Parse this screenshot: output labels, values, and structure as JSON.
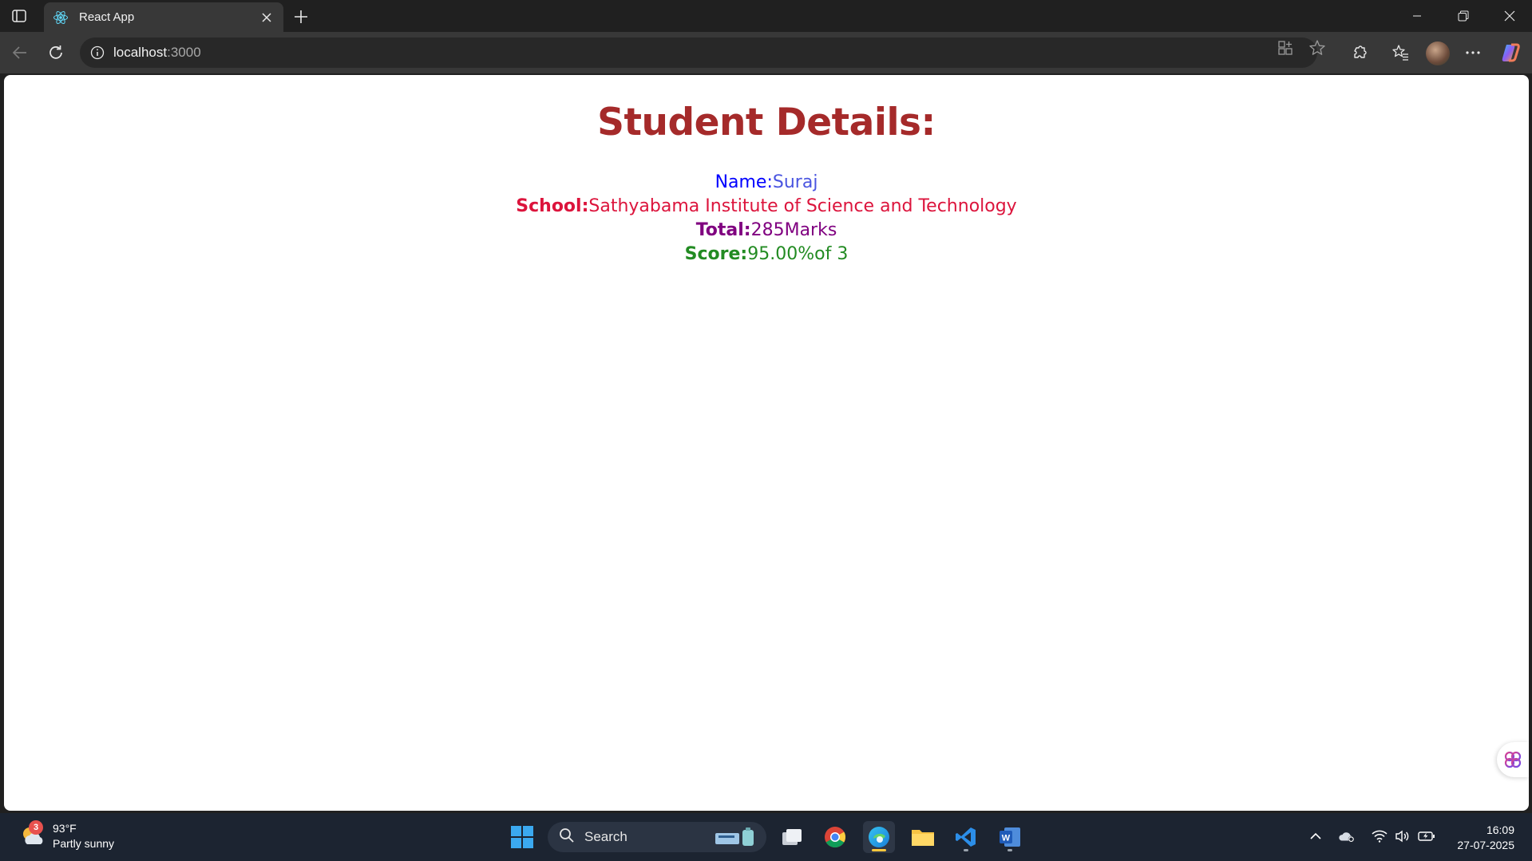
{
  "browser": {
    "tab_title": "React App",
    "url_host": "localhost",
    "url_port": ":3000"
  },
  "page": {
    "heading": "Student Details:",
    "name_label": "Name:",
    "name_value": "Suraj",
    "school_label": "School:",
    "school_value": "Sathyabama Institute of Science and Technology",
    "total_label": "Total:",
    "total_value": "285Marks",
    "score_label": "Score:",
    "score_value": "95.00%of 3"
  },
  "taskbar": {
    "weather_badge": "3",
    "temperature": "93°F",
    "condition": "Partly sunny",
    "search_label": "Search",
    "time": "16:09",
    "date": "27-07-2025"
  },
  "colors": {
    "heading": "#a52a2a",
    "name": "#0000ff",
    "school": "#dc143c",
    "total": "#800080",
    "score": "#228b22"
  }
}
